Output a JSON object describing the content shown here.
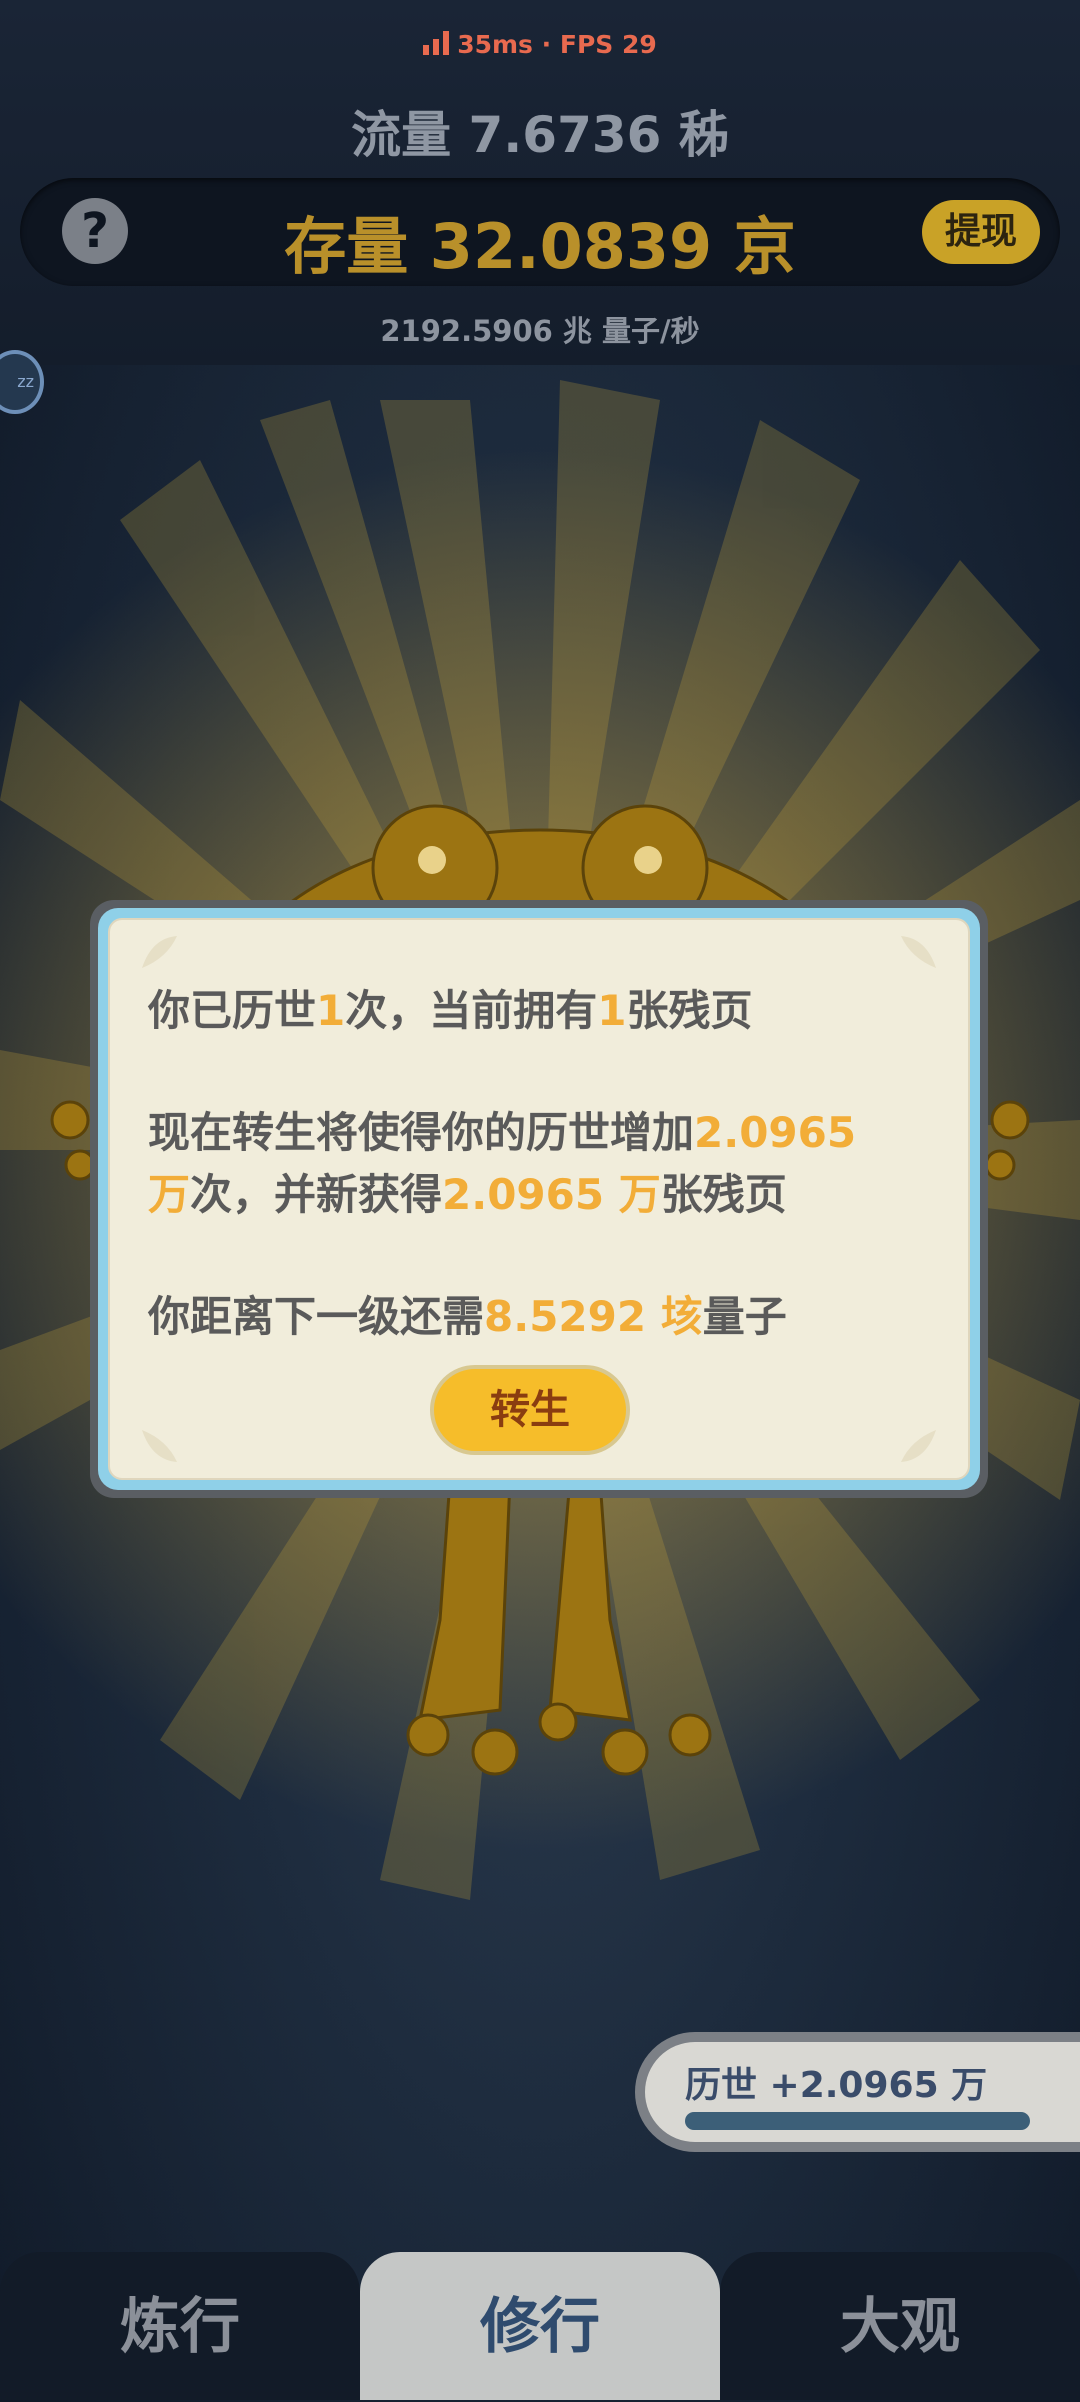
{
  "status": {
    "ping": "35ms",
    "fps": "FPS 29",
    "separator": "·"
  },
  "header": {
    "flow": "流量 7.6736 秭",
    "stock": "存量 32.0839 京",
    "withdraw_label": "提现",
    "help_icon_text": "?",
    "rate": "2192.5906 兆  量子/秒"
  },
  "badge": {
    "sleep_text": "zz"
  },
  "dialog": {
    "line1": {
      "a": "你已历世",
      "b": "1",
      "c": "次，当前拥有",
      "d": "1",
      "e": "张残页"
    },
    "line2": {
      "a": "现在转生将使得你的历世增加",
      "b": "2.0965",
      "c": "万",
      "d": "次，并新获得",
      "e": "2.0965 万",
      "f": "张残页"
    },
    "line3": {
      "a": "你距离下一级还需",
      "b": "8.5292 垓",
      "c": "量子"
    },
    "button_label": "转生"
  },
  "history": {
    "label": "历世 +2.0965 万",
    "progress": 1.0
  },
  "tabs": [
    {
      "label": "炼行"
    },
    {
      "label": "修行"
    },
    {
      "label": "大观"
    }
  ],
  "colors": {
    "accent": "#f2ad38",
    "stock": "#b9902a",
    "fps": "#e86a4f",
    "active_tab_text": "#2f4b6e"
  }
}
